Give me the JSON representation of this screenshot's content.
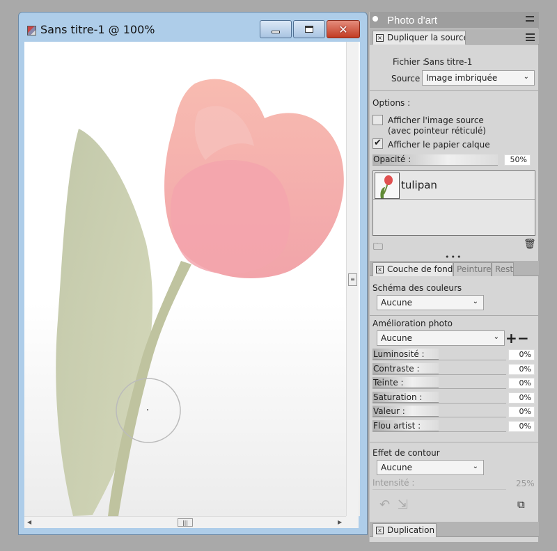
{
  "window": {
    "title": "Sans titre-1 @ 100%",
    "close_label": "✕"
  },
  "panel": {
    "title": "Photo d'art",
    "source_tab": "Dupliquer la source",
    "fichier_label": "Fichier :",
    "fichier_value": "Sans titre-1",
    "source_label": "Source :",
    "source_value": "Image imbriquée",
    "options_label": "Options :",
    "show_source_label": "Afficher l'image source",
    "show_source_sub": "(avec pointeur réticulé)",
    "show_source_checked": false,
    "show_tracing_label": "Afficher le papier calque",
    "show_tracing_checked": true,
    "opacity_label": "Opacité :",
    "opacity_value": "50%",
    "layer_name": "tulipan",
    "tabs": [
      "Couche de fond",
      "Peinture",
      "Rest"
    ],
    "color_scheme_label": "Schéma des couleurs",
    "color_scheme_value": "Aucune",
    "enhance_label": "Amélioration photo",
    "enhance_value": "Aucune",
    "adjust": [
      {
        "label": "Luminosité :",
        "value": "0%"
      },
      {
        "label": "Contraste :",
        "value": "0%"
      },
      {
        "label": "Teinte :",
        "value": "0%"
      },
      {
        "label": "Saturation :",
        "value": "0%"
      },
      {
        "label": "Valeur :",
        "value": "0%"
      },
      {
        "label": "Flou artist :",
        "value": "0%"
      }
    ],
    "contour_label": "Effet de contour",
    "contour_value": "Aucune",
    "intensity_label": "Intensité :",
    "intensity_value": "25%",
    "bottom_tab": "Duplication"
  }
}
